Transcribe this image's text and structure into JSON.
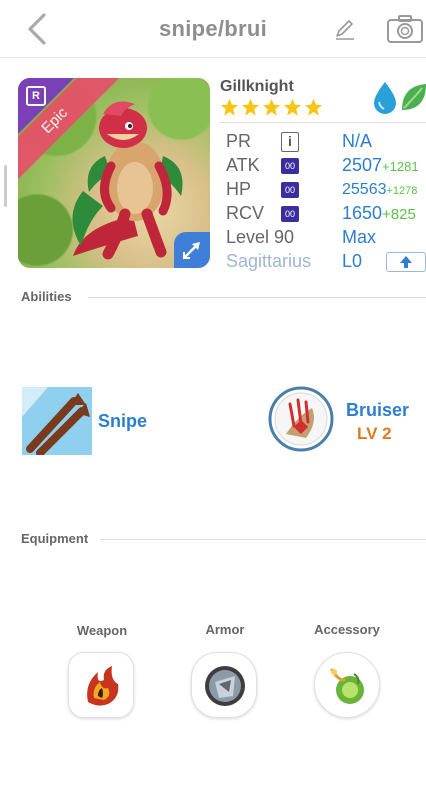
{
  "header": {
    "title": "snipe/brui"
  },
  "monster": {
    "name": "Gillknight",
    "rarity": "Epic",
    "rarity_letter": "R",
    "stars": 5,
    "elements": [
      "water",
      "leaf"
    ]
  },
  "stats": {
    "pr": {
      "label": "PR",
      "box": "i",
      "value": "N/A"
    },
    "atk": {
      "label": "ATK",
      "box": "00",
      "value": "2507",
      "plus": "+1281"
    },
    "hp": {
      "label": "HP",
      "box": "00",
      "value": "25563",
      "plus": "+1278"
    },
    "rcv": {
      "label": "RCV",
      "box": "00",
      "value": "1650",
      "plus": "+825"
    },
    "level": {
      "label": "Level 90",
      "value": "Max"
    },
    "sign": {
      "label": "Sagittarius",
      "value": "L0"
    }
  },
  "abilities": {
    "heading": "Abilities",
    "primary": {
      "name": "Snipe",
      "icon": "snipe-icon"
    },
    "secondary": {
      "name": "Bruiser",
      "level": "LV 2",
      "icon": "bruiser-icon"
    }
  },
  "equipment": {
    "heading": "Equipment",
    "slots": [
      {
        "label": "Weapon",
        "icon": "weapon-icon"
      },
      {
        "label": "Armor",
        "icon": "armor-icon"
      },
      {
        "label": "Accessory",
        "icon": "accessory-icon"
      }
    ]
  },
  "colors": {
    "accent_blue": "#2c7fd0",
    "plus_green": "#5bc24a",
    "level_orange": "#e07a20",
    "epic_ribbon": "#e8506a"
  }
}
